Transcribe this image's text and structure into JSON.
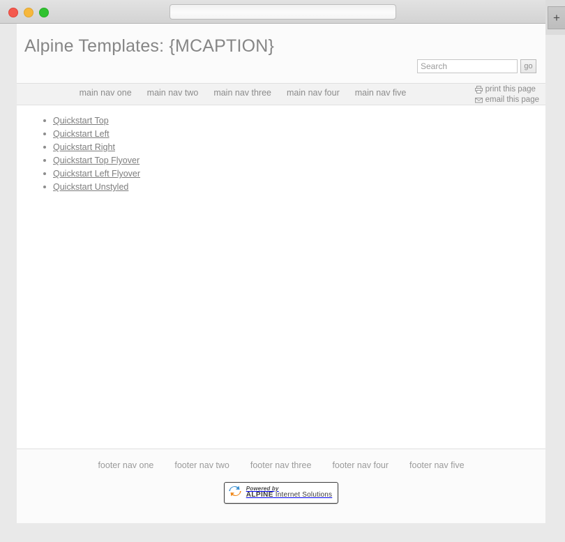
{
  "browser": {
    "address_bar_value": "",
    "address_bar_placeholder": "",
    "new_tab_label": "+",
    "traffic_lights": [
      "close",
      "minimize",
      "maximize"
    ]
  },
  "header": {
    "title": "Alpine Templates: {MCAPTION}"
  },
  "search": {
    "value": "",
    "placeholder": "Search",
    "go_label": "go"
  },
  "main_nav": {
    "items": [
      {
        "label": "main nav one"
      },
      {
        "label": "main nav two"
      },
      {
        "label": "main nav three"
      },
      {
        "label": "main nav four"
      },
      {
        "label": "main nav five"
      }
    ]
  },
  "utility_nav": {
    "items": [
      {
        "label": "print this page",
        "icon": "printer-icon"
      },
      {
        "label": "email this page",
        "icon": "envelope-icon"
      }
    ]
  },
  "content": {
    "links": [
      {
        "label": "Quickstart Top"
      },
      {
        "label": "Quickstart Left"
      },
      {
        "label": "Quickstart Right"
      },
      {
        "label": "Quickstart Top Flyover"
      },
      {
        "label": "Quickstart Left Flyover"
      },
      {
        "label": "Quickstart Unstyled"
      }
    ]
  },
  "footer_nav": {
    "items": [
      {
        "label": "footer nav one"
      },
      {
        "label": "footer nav two"
      },
      {
        "label": "footer nav three"
      },
      {
        "label": "footer nav four"
      },
      {
        "label": "footer nav five"
      }
    ]
  },
  "powered_by": {
    "tagline": "Powered by",
    "brand": "ALPINE",
    "brand_suffix": "Internet Solutions",
    "logo_icon": "alpine-refresh-logo-icon"
  },
  "colors": {
    "page_background": "#fbfbfb",
    "content_background": "#ffffff",
    "chrome_background": "#e9e9e9",
    "title_text": "#868686",
    "nav_text": "#8b8b8b",
    "link_text": "#7d7d7d",
    "divider": "#e0e0e0",
    "nav_band": "#f2f2f2",
    "logo_blue": "#3a8fd0",
    "logo_orange": "#f08a1e",
    "light_close": "#f45a4e",
    "light_min": "#f6b73c",
    "light_max": "#2fc22f"
  }
}
